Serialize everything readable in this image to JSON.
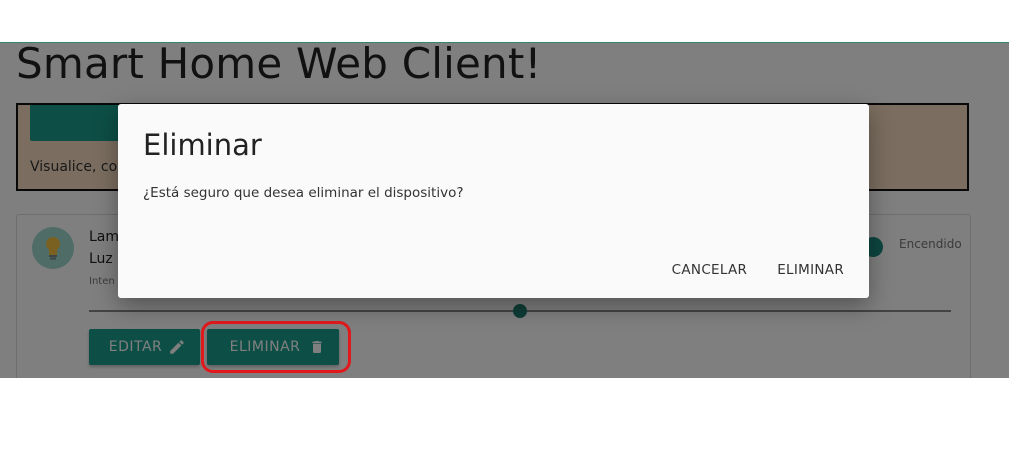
{
  "app": {
    "title": "Smart Home Web Client!",
    "banner_text": "Visualice, con"
  },
  "device": {
    "name": "Lamp",
    "type": "Luz l",
    "intensity_label": "Inten",
    "status": "Encendido",
    "intensity_percent": 50,
    "edit_label": "EDITAR",
    "delete_label": "ELIMINAR",
    "icons": {
      "avatar": "lightbulb-icon",
      "edit": "pencil-icon",
      "delete": "trash-icon"
    }
  },
  "dialog": {
    "title": "Eliminar",
    "message": "¿Está seguro que desea eliminar el dispositivo?",
    "cancel_label": "CANCELAR",
    "confirm_label": "ELIMINAR"
  },
  "colors": {
    "primary": "#1a9e8c",
    "banner": "#f6dcc0",
    "highlight": "#e1191c"
  }
}
